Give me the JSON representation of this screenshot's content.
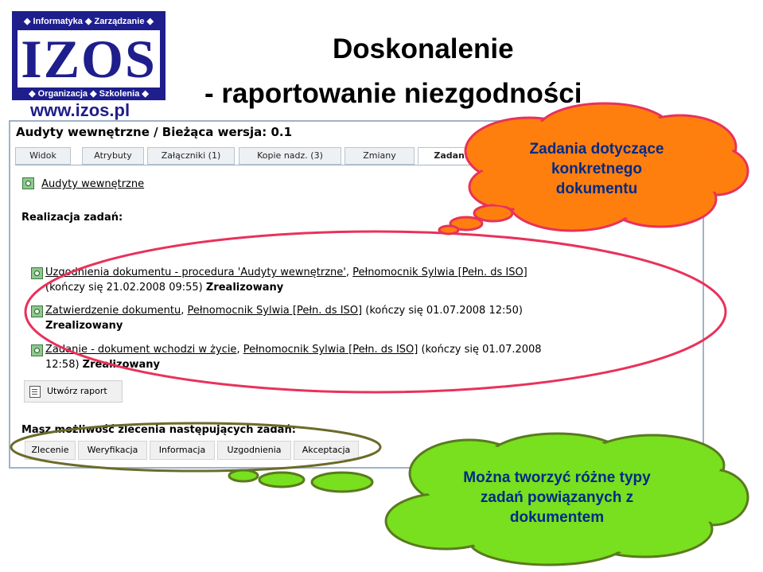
{
  "logo": {
    "top_text": "◆ Informatyka ◆ Zarządzanie ◆",
    "name": "IZOS",
    "bottom_text": "◆ Organizacja ◆ Szkolenia ◆",
    "url": "www.izos.pl"
  },
  "slide": {
    "title_line1": "Doskonalenie",
    "title_line2": "- raportowanie niezgodności"
  },
  "app": {
    "title": "Audyty wewnętrzne / Bieżąca wersja: 0.1",
    "tabs": [
      {
        "label": "Widok"
      },
      {
        "label": "Atrybuty"
      },
      {
        "label": "Załączniki (1)"
      },
      {
        "label": "Kopie nadz. (3)"
      },
      {
        "label": "Zmiany"
      },
      {
        "label": "Zadania (3)"
      }
    ],
    "active_tab_index": 5,
    "document_link": "Audyty wewnętrzne",
    "realization_heading": "Realizacja zadań:",
    "tasks": [
      {
        "link": "Uzgodnienia dokumentu - procedura 'Audyty wewnętrzne'",
        "sep": ", ",
        "person": "Pełnomocnik Sylwia [Pełn. ds ISO]",
        "deadline_line": "(kończy się 21.02.2008 09:55)",
        "status": "Zrealizowany"
      },
      {
        "link": "Zatwierdzenie dokumentu",
        "sep": ", ",
        "person": "Pełnomocnik Sylwia [Pełn. ds ISO]",
        "deadline": " (kończy się 01.07.2008 12:50)",
        "status": "Zrealizowany"
      },
      {
        "link": "Zadanie - dokument wchodzi w życie",
        "sep": ", ",
        "person": "Pełnomocnik Sylwia [Pełn. ds ISO]",
        "deadline_a": " (kończy się 01.07.2008",
        "deadline_b": "12:58) ",
        "status": "Zrealizowany"
      }
    ],
    "report_button": "Utwórz raport",
    "new_tasks_heading": "Masz możliwość zlecenia następujących zadań:",
    "task_buttons": [
      {
        "label": "Zlecenie"
      },
      {
        "label": "Weryfikacja"
      },
      {
        "label": "Informacja"
      },
      {
        "label": "Uzgodnienia"
      },
      {
        "label": "Akceptacja"
      }
    ]
  },
  "callouts": {
    "orange": {
      "text_lines": [
        "Zadania dotyczące",
        "konkretnego",
        "dokumentu"
      ],
      "fill": "#ff7f0e",
      "stroke": "#e8325a"
    },
    "green": {
      "text_lines": [
        "Można tworzyć różne typy",
        "zadań powiązanych z",
        "dokumentem"
      ],
      "fill": "#78e01e",
      "stroke": "#5a7a1e"
    },
    "highlight_colors": {
      "tasks_ellipse": "#e8325a",
      "buttons_ellipse": "#6b6b2a"
    }
  }
}
